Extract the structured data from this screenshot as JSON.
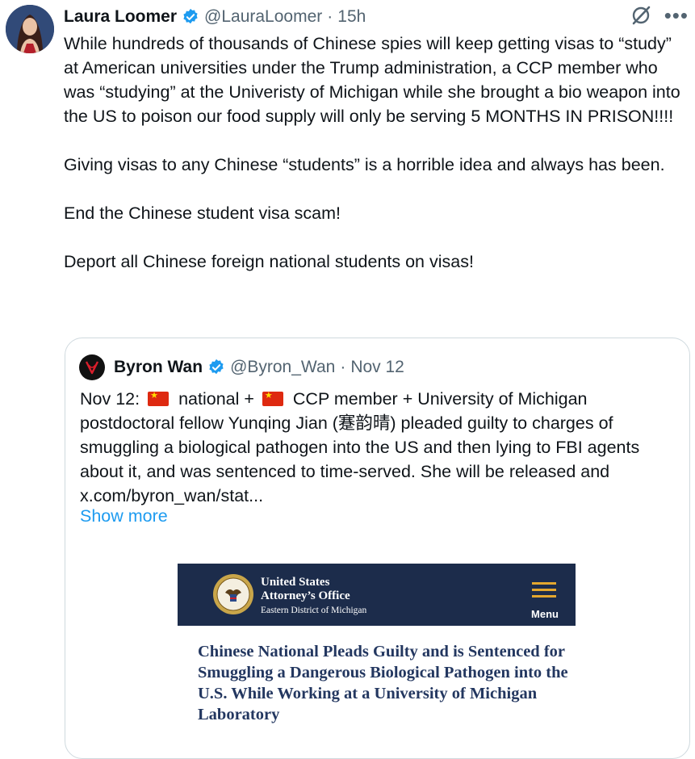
{
  "tweet": {
    "author": {
      "name": "Laura Loomer",
      "handle": "@LauraLoomer",
      "time": "15h"
    },
    "text": "While hundreds of thousands of Chinese spies will keep getting visas to “study” at American universities under the Trump administration, a CCP member who was “studying” at the Univeristy of Michigan while she brought a bio weapon into the US to poison our food supply will only be serving 5 MONTHS IN PRISON!!!!\n\nGiving visas to any Chinese “students” is a horrible idea and always has been.\n\nEnd the Chinese student visa scam!\n\nDeport all Chinese foreign national students on visas!",
    "separator": "·",
    "more_icon": "•••"
  },
  "quote": {
    "author": {
      "name": "Byron Wan",
      "handle": "@Byron_Wan",
      "time": "Nov 12"
    },
    "text_parts": {
      "p1": "Nov 12:",
      "p2": "national +",
      "p3": "CCP member + University of Michigan postdoctoral fellow Yunqing Jian (蹇韵晴) pleaded guilty to charges of smuggling a biological pathogen into the US and then lying to FBI agents about it, and was sentenced to time-served. She will be released and  x.com/byron_wan/stat..."
    },
    "show_more": "Show more",
    "image": {
      "org_title_line1": "United States",
      "org_title_line2": "Attorney’s Office",
      "org_subtitle": "Eastern District of Michigan",
      "menu_label": "Menu",
      "headline": "Chinese National Pleads Guilty and is Sentenced for Smuggling a Dangerous Biological Pathogen into the U.S. While Working at a University of Michigan Laboratory"
    }
  },
  "colors": {
    "verified": "#1d9bf0",
    "link": "#1d9bf0",
    "banner_bg": "#1c2c4b",
    "headline": "#233760"
  },
  "icons": [
    "verified-badge-icon",
    "grok-icon",
    "more-icon",
    "china-flag-icon",
    "menu-icon",
    "doj-seal-icon"
  ]
}
